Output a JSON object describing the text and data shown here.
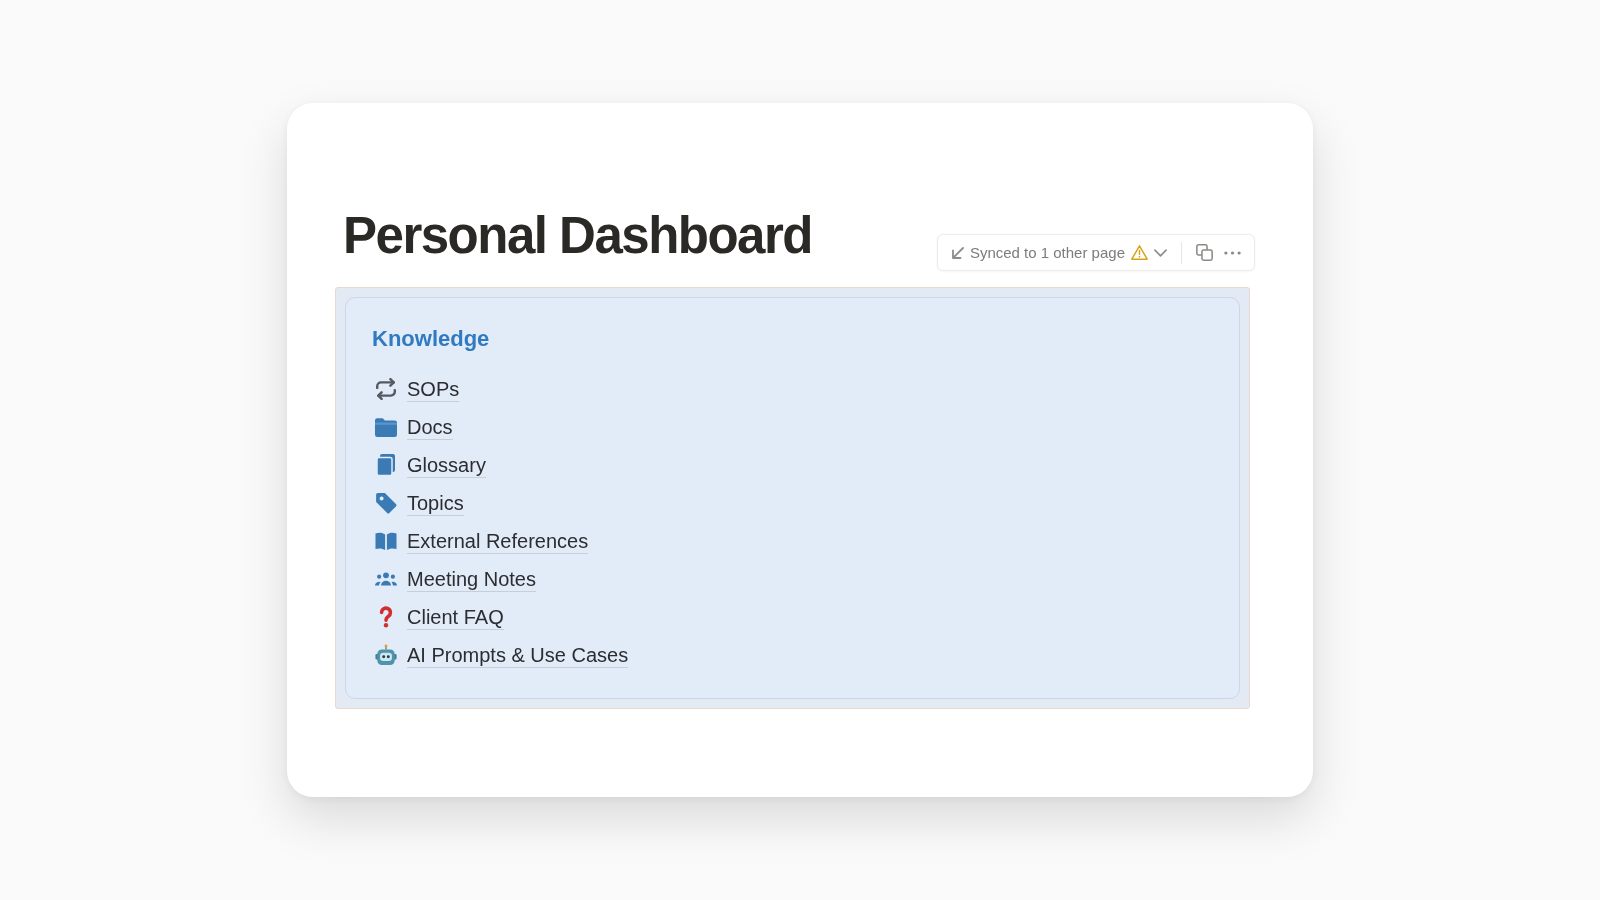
{
  "page": {
    "title": "Personal Dashboard"
  },
  "sync_toolbar": {
    "label": "Synced to 1 other page"
  },
  "synced_block": {
    "heading": "Knowledge",
    "links": [
      {
        "label": "SOPs"
      },
      {
        "label": "Docs"
      },
      {
        "label": "Glossary"
      },
      {
        "label": "Topics"
      },
      {
        "label": "External References"
      },
      {
        "label": "Meeting Notes"
      },
      {
        "label": "Client FAQ"
      },
      {
        "label": "AI Prompts & Use Cases"
      }
    ]
  }
}
